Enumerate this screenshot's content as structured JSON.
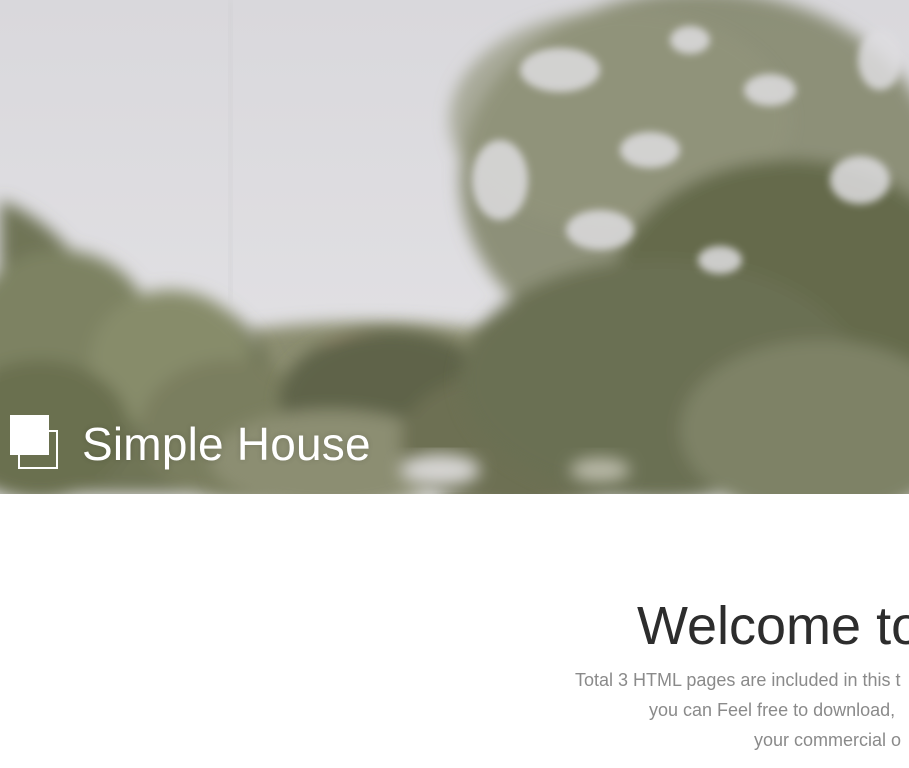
{
  "header": {
    "site_title": "Simple House",
    "logo_icon": "overlapping-squares-icon"
  },
  "main": {
    "welcome_heading": "Welcome to",
    "description_lines": [
      "Total 3 HTML pages are included in this t",
      "you can Feel free to download,",
      "your commercial o"
    ]
  },
  "colors": {
    "title_text": "#ffffff",
    "heading_text": "#2d2d2d",
    "body_text": "#8a8a8a",
    "page_background": "#ffffff"
  }
}
